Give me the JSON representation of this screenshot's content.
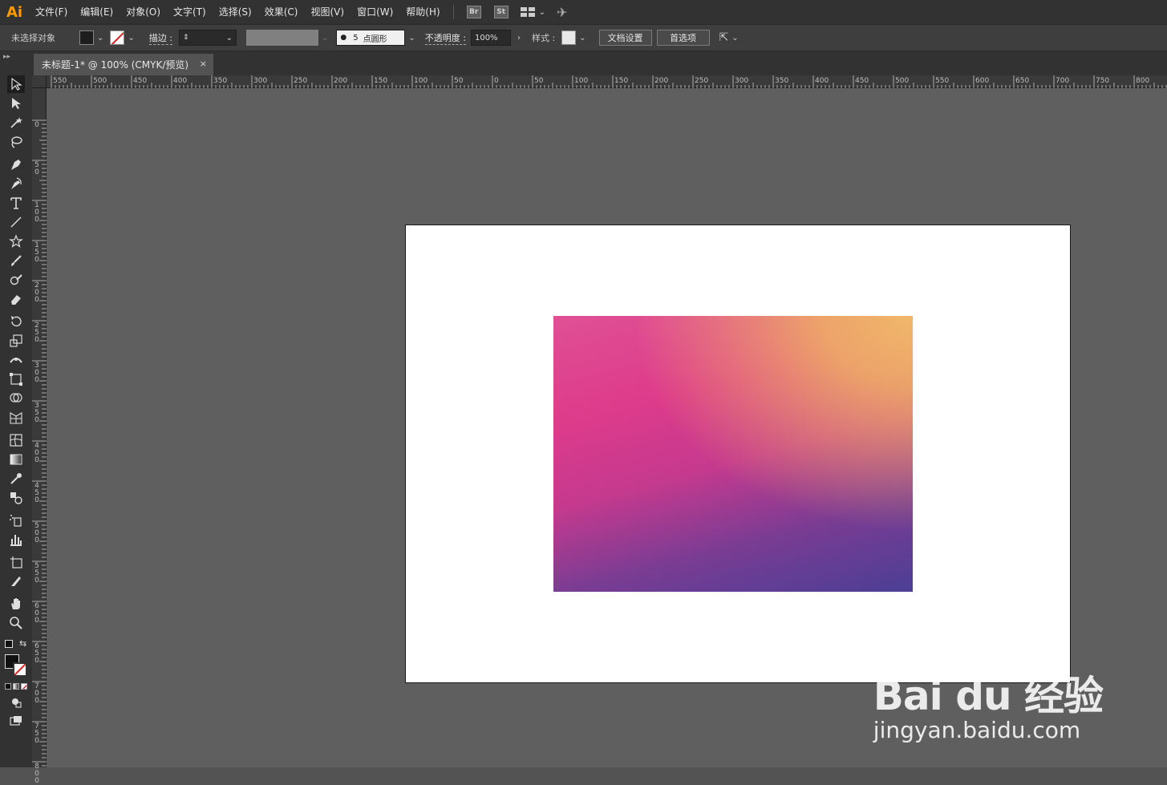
{
  "app": {
    "logo": "Ai"
  },
  "menu": {
    "items": [
      "文件(F)",
      "编辑(E)",
      "对象(O)",
      "文字(T)",
      "选择(S)",
      "效果(C)",
      "视图(V)",
      "窗口(W)",
      "帮助(H)"
    ],
    "bridge": "Br",
    "stock": "St"
  },
  "control": {
    "no_selection": "未选择对象",
    "stroke_label": "描边 :",
    "brush_size": "5",
    "brush_name": "点圆形",
    "opacity_label": "不透明度 :",
    "opacity_value": "100%",
    "style_label": "样式 :",
    "doc_setup": "文档设置",
    "preferences": "首选项"
  },
  "document": {
    "tab_title": "未标题-1* @ 100% (CMYK/预览)",
    "close_glyph": "×"
  },
  "ruler_h": [
    "550",
    "500",
    "450",
    "400",
    "350",
    "300",
    "250",
    "200",
    "150",
    "100",
    "50",
    "0",
    "50",
    "100",
    "150",
    "200",
    "250",
    "300",
    "350",
    "400",
    "450",
    "500",
    "550",
    "600",
    "650",
    "700",
    "750",
    "800"
  ],
  "ruler_v": [
    "0",
    "50",
    "100",
    "150",
    "200",
    "250",
    "300",
    "350",
    "400",
    "450",
    "500",
    "550",
    "600",
    "650",
    "700",
    "750",
    "800"
  ],
  "watermark": {
    "brand": "Bai du 经验",
    "url": "jingyan.baidu.com"
  },
  "colors": {
    "gradient_top_right": "#f0b86a",
    "gradient_mid": "#dd3b8b",
    "gradient_bottom_left": "#4b3f95"
  }
}
